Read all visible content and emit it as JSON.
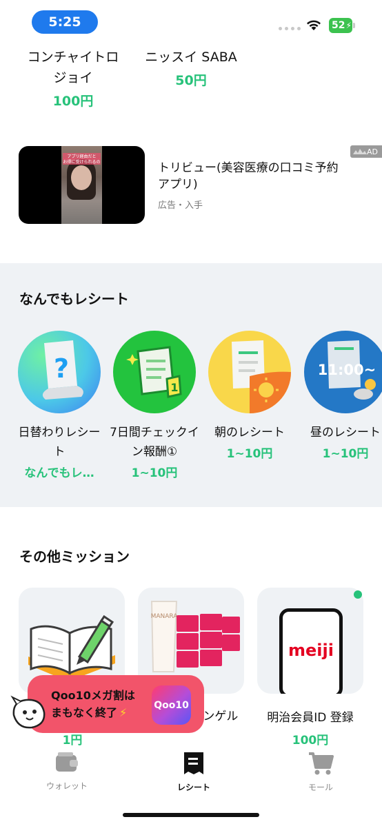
{
  "status_bar": {
    "time": "5:25",
    "battery": "52"
  },
  "products": [
    {
      "name": "コンチャイトロジョイ",
      "price": "100円"
    },
    {
      "name": "ニッスイ SABA",
      "price": "50円"
    }
  ],
  "ad": {
    "image_caption_1": "アプリ経由だと",
    "image_caption_2": "お得に受けられるの",
    "title": "トリビュー(美容医療の口コミ予約アプリ)",
    "meta": "広告・入手",
    "badge": "AD"
  },
  "receipt_section": {
    "title": "なんでもレシート",
    "items": [
      {
        "name": "日替わりレシート",
        "reward": "なんでもレ…"
      },
      {
        "name": "7日間チェックイン報酬①",
        "reward": "1~10円"
      },
      {
        "name": "朝のレシート",
        "reward": "1~10円"
      },
      {
        "name": "昼のレシート",
        "reward": "1~10円"
      }
    ],
    "noon_time_label": "11:00~"
  },
  "mission_section": {
    "title": "その他ミッション",
    "cards": [
      {
        "name": "",
        "price": "1円"
      },
      {
        "name": "レンジ ンゲル",
        "price": "",
        "product_text": "MANARA"
      },
      {
        "name": "明治会員ID 登録",
        "price": "100円",
        "logo_text": "meiji"
      }
    ]
  },
  "qoo_banner": {
    "line1": "Qoo10メガ割は",
    "line2": "まもなく終了",
    "logo": "Qoo10"
  },
  "tab_bar": {
    "tabs": [
      {
        "label": "ウォレット",
        "icon": "wallet-icon"
      },
      {
        "label": "レシート",
        "icon": "receipt-icon"
      },
      {
        "label": "モール",
        "icon": "cart-icon"
      }
    ]
  },
  "colors": {
    "accent_green": "#27c27a",
    "time_pill": "#1f7aed",
    "section_bg": "#eff2f5",
    "banner": "#f2546a"
  }
}
